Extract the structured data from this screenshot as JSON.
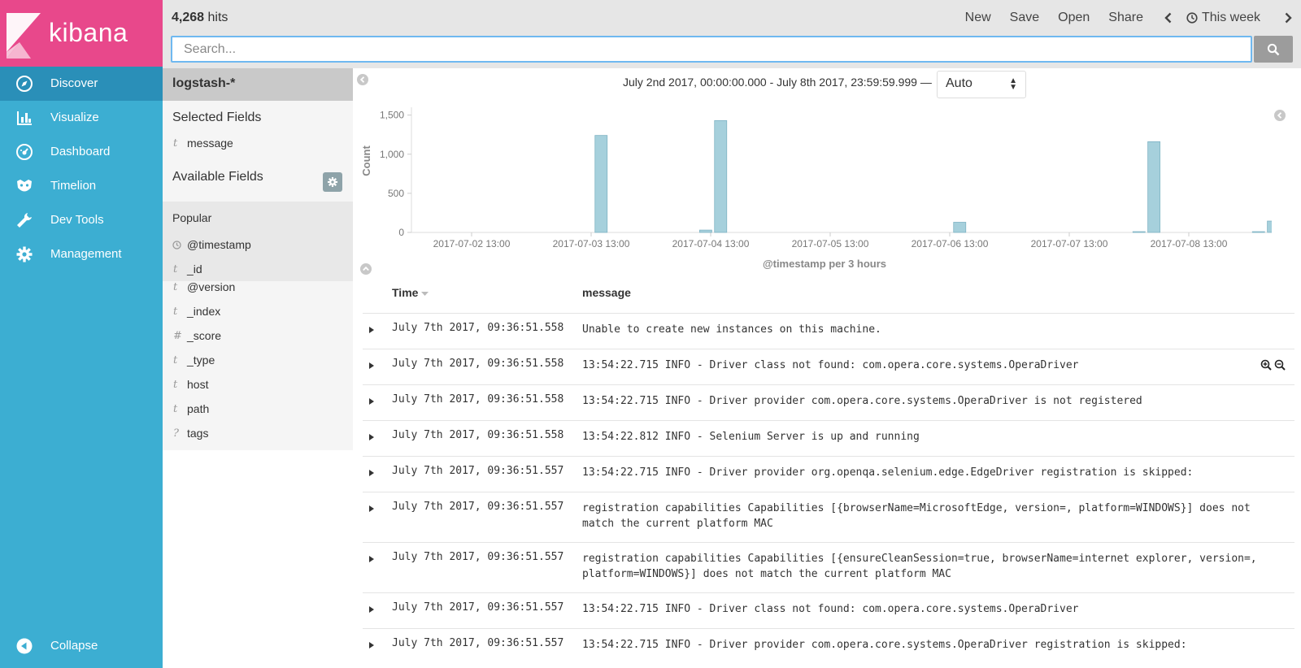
{
  "app": {
    "brand": "kibana",
    "brand_color": "#e8488b",
    "sidebar_color": "#3caed2"
  },
  "sidebar": {
    "items": [
      {
        "label": "Discover",
        "icon": "compass-icon",
        "active": true
      },
      {
        "label": "Visualize",
        "icon": "bar-chart-icon",
        "active": false
      },
      {
        "label": "Dashboard",
        "icon": "dashboard-gauge-icon",
        "active": false
      },
      {
        "label": "Timelion",
        "icon": "timelion-mask-icon",
        "active": false
      },
      {
        "label": "Dev Tools",
        "icon": "wrench-icon",
        "active": false
      },
      {
        "label": "Management",
        "icon": "gear-icon",
        "active": false
      }
    ],
    "collapse_label": "Collapse"
  },
  "topbar": {
    "hits_count": "4,268",
    "hits_label": "hits",
    "new_label": "New",
    "save_label": "Save",
    "open_label": "Open",
    "share_label": "Share",
    "time_label": "This week"
  },
  "search": {
    "placeholder": "Search...",
    "value": ""
  },
  "fields": {
    "index_pattern": "logstash-*",
    "selected_heading": "Selected Fields",
    "selected": [
      {
        "type": "t",
        "name": "message"
      }
    ],
    "available_heading": "Available Fields",
    "popular_heading": "Popular",
    "popular": [
      {
        "type": "clock",
        "name": "@timestamp"
      },
      {
        "type": "t",
        "name": "_id"
      }
    ],
    "others": [
      {
        "type": "t",
        "name": "@version"
      },
      {
        "type": "t",
        "name": "_index"
      },
      {
        "type": "#",
        "name": "_score"
      },
      {
        "type": "t",
        "name": "_type"
      },
      {
        "type": "t",
        "name": "host"
      },
      {
        "type": "t",
        "name": "path"
      },
      {
        "type": "?",
        "name": "tags"
      }
    ]
  },
  "chart_header": {
    "date_range": "July 2nd 2017, 00:00:00.000 - July 8th 2017, 23:59:59.999 —",
    "interval": "Auto"
  },
  "chart_data": {
    "type": "bar",
    "xlabel": "@timestamp per 3 hours",
    "ylabel": "Count",
    "ylim": [
      0,
      1600
    ],
    "yticks": [
      "0",
      "500",
      "1,000",
      "1,500"
    ],
    "xticks": [
      "2017-07-02 13:00",
      "2017-07-03 13:00",
      "2017-07-04 13:00",
      "2017-07-05 13:00",
      "2017-07-06 13:00",
      "2017-07-07 13:00",
      "2017-07-08 13:00"
    ],
    "bar_color": "#a6d0dc",
    "bars": [
      {
        "hours": 39,
        "value": 1240
      },
      {
        "hours": 60,
        "value": 30
      },
      {
        "hours": 63,
        "value": 1430
      },
      {
        "hours": 111,
        "value": 130
      },
      {
        "hours": 147,
        "value": 10
      },
      {
        "hours": 150,
        "value": 1160
      },
      {
        "hours": 171,
        "value": 10
      },
      {
        "hours": 174,
        "value": 145
      },
      {
        "hours": 198,
        "value": 95
      }
    ],
    "now_marker_hours": 196,
    "now_marker_color": "#e06060",
    "grid": false,
    "legend": "none"
  },
  "table": {
    "time_header": "Time",
    "message_header": "message",
    "rows": [
      {
        "time": "July 7th 2017, 09:36:51.558",
        "message": "Unable to create new instances on this machine."
      },
      {
        "time": "July 7th 2017, 09:36:51.558",
        "message": "13:54:22.715 INFO - Driver class not found: com.opera.core.systems.OperaDriver"
      },
      {
        "time": "July 7th 2017, 09:36:51.558",
        "message": "13:54:22.715 INFO - Driver provider com.opera.core.systems.OperaDriver is not registered"
      },
      {
        "time": "July 7th 2017, 09:36:51.558",
        "message": "13:54:22.812 INFO - Selenium Server is up and running"
      },
      {
        "time": "July 7th 2017, 09:36:51.557",
        "message": "13:54:22.715 INFO - Driver provider org.openqa.selenium.edge.EdgeDriver registration is skipped:"
      },
      {
        "time": "July 7th 2017, 09:36:51.557",
        "message": " registration capabilities Capabilities [{browserName=MicrosoftEdge, version=, platform=WINDOWS}] does not match the current platform MAC"
      },
      {
        "time": "July 7th 2017, 09:36:51.557",
        "message": " registration capabilities Capabilities [{ensureCleanSession=true, browserName=internet explorer, version=, platform=WINDOWS}] does not match the current platform MAC"
      },
      {
        "time": "July 7th 2017, 09:36:51.557",
        "message": "13:54:22.715 INFO - Driver class not found: com.opera.core.systems.OperaDriver"
      },
      {
        "time": "July 7th 2017, 09:36:51.557",
        "message": "13:54:22.715 INFO - Driver provider com.opera.core.systems.OperaDriver registration is skipped:"
      }
    ]
  }
}
